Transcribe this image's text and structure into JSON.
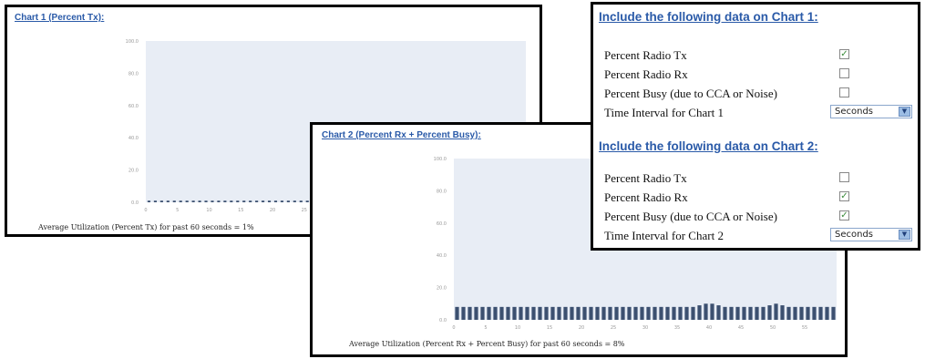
{
  "chart1": {
    "title": "Chart 1 (Percent Tx):",
    "caption": "Average Utilization (Percent Tx) for past 60 seconds = 1%"
  },
  "chart2": {
    "title": "Chart 2 (Percent Rx + Percent Busy):",
    "caption": "Average Utilization (Percent Rx + Percent Busy) for past 60 seconds = 8%"
  },
  "options": {
    "chart1_heading": "Include the following data on Chart 1:",
    "chart2_heading": "Include the following data on Chart 2:",
    "chart1_rows": [
      {
        "label": "Percent Radio Tx",
        "checked": true
      },
      {
        "label": "Percent Radio Rx",
        "checked": false
      },
      {
        "label": "Percent Busy (due to CCA or Noise)",
        "checked": false
      }
    ],
    "chart1_interval_label": "Time Interval for Chart 1",
    "chart1_interval_value": "Seconds",
    "chart2_rows": [
      {
        "label": "Percent Radio Tx",
        "checked": false
      },
      {
        "label": "Percent Radio Rx",
        "checked": true
      },
      {
        "label": "Percent Busy (due to CCA or Noise)",
        "checked": true
      }
    ],
    "chart2_interval_label": "Time Interval for Chart 2",
    "chart2_interval_value": "Seconds",
    "check_glyph": "✓"
  },
  "chart_data": [
    {
      "type": "bar",
      "y_ticks": [
        "100.0",
        "80.0",
        "60.0",
        "40.0",
        "20.0",
        "0.0"
      ],
      "x_ticks": [
        "0",
        "5",
        "10",
        "15",
        "20",
        "25"
      ],
      "ylim": [
        0,
        100
      ],
      "xlim": [
        0,
        60
      ],
      "values": [
        1,
        1,
        1,
        1,
        1,
        1,
        1,
        1,
        1,
        1,
        1,
        1,
        1,
        1,
        1,
        1,
        1,
        1,
        1,
        1,
        1,
        1,
        1,
        1,
        1,
        1,
        1,
        1,
        1,
        1,
        1,
        1,
        1,
        1,
        1,
        1,
        1,
        1,
        1,
        1,
        1,
        1,
        1,
        1,
        1,
        1,
        1,
        1,
        1,
        1,
        1,
        1,
        1,
        1,
        1,
        1,
        1,
        1,
        1,
        1
      ],
      "plot_bg": "#e8edf5",
      "bar_color": "#3c5070"
    },
    {
      "type": "bar",
      "y_ticks": [
        "100.0",
        "80.0",
        "60.0",
        "40.0",
        "20.0",
        "0.0"
      ],
      "x_ticks": [
        "0",
        "5",
        "10",
        "15",
        "20",
        "25",
        "30",
        "35",
        "40",
        "45",
        "50",
        "55"
      ],
      "ylim": [
        0,
        100
      ],
      "xlim": [
        0,
        60
      ],
      "values": [
        8,
        8,
        8,
        8,
        8,
        8,
        8,
        8,
        8,
        8,
        8,
        8,
        8,
        8,
        8,
        8,
        8,
        8,
        8,
        8,
        8,
        8,
        8,
        8,
        8,
        8,
        8,
        8,
        8,
        8,
        8,
        8,
        8,
        8,
        8,
        8,
        8,
        8,
        9,
        10,
        10,
        9,
        8,
        8,
        8,
        8,
        8,
        8,
        8,
        9,
        10,
        9,
        8,
        8,
        8,
        8,
        8,
        8,
        8,
        8
      ],
      "plot_bg": "#e8edf5",
      "bar_color": "#3c5070"
    }
  ]
}
